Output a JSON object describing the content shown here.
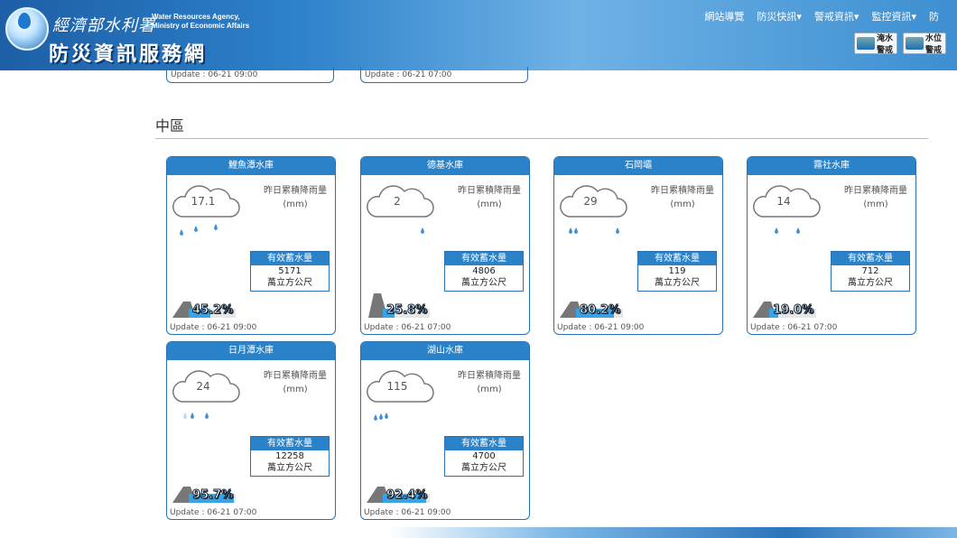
{
  "header": {
    "agency_cn": "經濟部水利署",
    "agency_en_1": "Water Resources Agency,",
    "agency_en_2": "Ministry of Economic Affairs",
    "site_title": "防災資訊服務網",
    "nav": [
      "網站導覽",
      "防災快訊▾",
      "警戒資訊▾",
      "監控資訊▾",
      "防"
    ],
    "alert_buttons": [
      {
        "label_1": "淹水",
        "label_2": "警戒"
      },
      {
        "label_1": "水位",
        "label_2": "警戒"
      }
    ]
  },
  "top_partials": [
    {
      "update": "Update : 06-21 09:00"
    },
    {
      "update": "Update : 06-21 07:00"
    }
  ],
  "section": {
    "title": "中區"
  },
  "labels": {
    "rain_label_1": "昨日累積降雨量",
    "rain_label_2": "(mm)",
    "storage_head": "有效蓄水量",
    "storage_unit": "萬立方公尺"
  },
  "reservoirs": [
    {
      "name": "鯉魚潭水庫",
      "rain": "17.1",
      "storage": "5171",
      "percent": "45.2%",
      "percent_value": 0.452,
      "update": "Update : 06-21 09:00"
    },
    {
      "name": "德基水庫",
      "rain": "2",
      "storage": "4806",
      "percent": "25.8%",
      "percent_value": 0.258,
      "update": "Update : 06-21 07:00"
    },
    {
      "name": "石岡壩",
      "rain": "29",
      "storage": "119",
      "percent": "80.2%",
      "percent_value": 0.802,
      "update": "Update : 06-21 09:00"
    },
    {
      "name": "霧社水庫",
      "rain": "14",
      "storage": "712",
      "percent": "19.0%",
      "percent_value": 0.19,
      "update": "Update : 06-21 07:00"
    },
    {
      "name": "日月潭水庫",
      "rain": "24",
      "storage": "12258",
      "percent": "95.7%",
      "percent_value": 0.957,
      "update": "Update : 06-21 07:00"
    },
    {
      "name": "湖山水庫",
      "rain": "115",
      "storage": "4700",
      "percent": "92.4%",
      "percent_value": 0.924,
      "update": "Update : 06-21 09:00"
    }
  ],
  "colors": {
    "accent": "#2a83c9",
    "fill": "#3aa3e5",
    "drop": "#3b8fd6"
  }
}
